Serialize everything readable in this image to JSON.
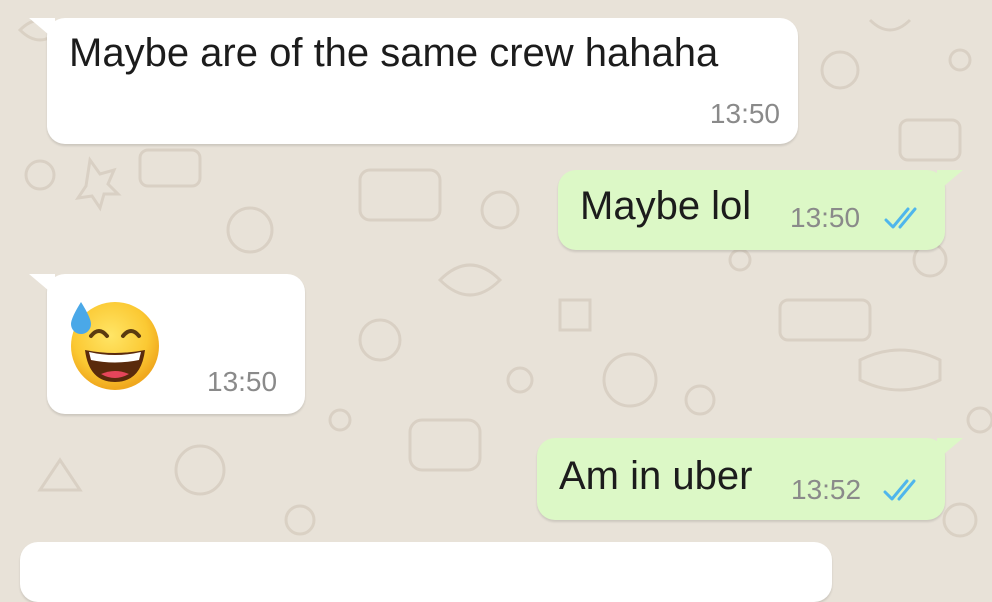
{
  "conversation": {
    "messages": [
      {
        "direction": "incoming",
        "text": "Maybe are of the same crew hahaha",
        "time": "13:50"
      },
      {
        "direction": "outgoing",
        "text": "Maybe lol",
        "time": "13:50",
        "status": "read"
      },
      {
        "direction": "incoming",
        "emoji": "grinning-face-with-sweat",
        "time": "13:50"
      },
      {
        "direction": "outgoing",
        "text": "Am in uber",
        "time": "13:52",
        "status": "read"
      },
      {
        "direction": "incoming",
        "text": ""
      }
    ]
  },
  "colors": {
    "background": "#e8e2d8",
    "incoming_bubble": "#ffffff",
    "outgoing_bubble": "#dcf8c6",
    "read_ticks": "#4fb6ec",
    "timestamp": "#8a8a8a"
  }
}
